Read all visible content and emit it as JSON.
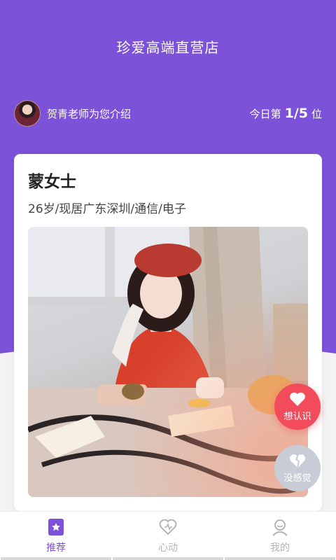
{
  "header": {
    "title": "珍爱高端直营店"
  },
  "intro": {
    "text": "贺青老师为您介绍",
    "rank_prefix": "今日第",
    "rank_value": "1/5",
    "rank_suffix": "位"
  },
  "profile": {
    "name": "蒙女士",
    "info": "26岁/现居广东深圳/通信/电子"
  },
  "actions": {
    "like_label": "想认识",
    "pass_label": "没感觉"
  },
  "tabs": [
    {
      "label": "推荐",
      "icon": "star-bookmark-icon",
      "active": true
    },
    {
      "label": "心动",
      "icon": "heart-icon",
      "active": false
    },
    {
      "label": "我的",
      "icon": "person-icon",
      "active": false
    }
  ],
  "colors": {
    "accent": "#7c52d8",
    "like": "#f24c5c",
    "pass": "#c7ccd7"
  }
}
